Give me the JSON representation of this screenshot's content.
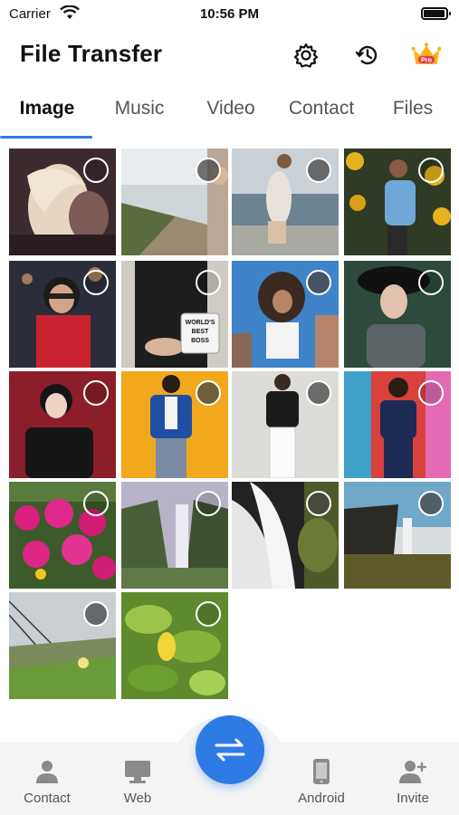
{
  "status_bar": {
    "carrier": "Carrier",
    "time": "10:56 PM"
  },
  "header": {
    "title": "File Transfer",
    "pro_badge": "Pro"
  },
  "tabs": [
    {
      "label": "Image",
      "active": true
    },
    {
      "label": "Music",
      "active": false
    },
    {
      "label": "Video",
      "active": false
    },
    {
      "label": "Contact",
      "active": false
    },
    {
      "label": "Files",
      "active": false
    }
  ],
  "grid": {
    "items": [
      {
        "subject": "blonde-woman-hair",
        "selector": "clear"
      },
      {
        "subject": "street-scene",
        "selector": "filled"
      },
      {
        "subject": "woman-rocks-sea",
        "selector": "filled"
      },
      {
        "subject": "woman-sunflowers",
        "selector": "clear"
      },
      {
        "subject": "woman-sunglasses-night",
        "selector": "clear"
      },
      {
        "subject": "woman-mug",
        "selector": "clear"
      },
      {
        "subject": "woman-city-sky",
        "selector": "filled"
      },
      {
        "subject": "woman-black-hat",
        "selector": "clear"
      },
      {
        "subject": "woman-red-wall",
        "selector": "clear"
      },
      {
        "subject": "woman-blue-blazer",
        "selector": "filled"
      },
      {
        "subject": "woman-white-pants",
        "selector": "filled"
      },
      {
        "subject": "woman-colorful-wall",
        "selector": "clear"
      },
      {
        "subject": "pink-flowers",
        "selector": "clear"
      },
      {
        "subject": "waterfall-valley",
        "selector": "clear"
      },
      {
        "subject": "waterfall-rocks",
        "selector": "filled"
      },
      {
        "subject": "waterfall-coast",
        "selector": "filled"
      },
      {
        "subject": "hillside-flowers",
        "selector": "filled"
      },
      {
        "subject": "green-leaves",
        "selector": "clear"
      }
    ],
    "mug_text": "WORLD'S BEST BOSS"
  },
  "bottom_nav": {
    "items": [
      {
        "label": "Contact",
        "icon": "person-icon"
      },
      {
        "label": "Web",
        "icon": "monitor-icon"
      },
      {
        "label": "Android",
        "icon": "phone-icon"
      },
      {
        "label": "Invite",
        "icon": "add-person-icon"
      }
    ],
    "center_button_icon": "transfer-arrows-icon"
  },
  "colors": {
    "accent": "#2f7be5",
    "nav_background": "#f4f4f5"
  }
}
